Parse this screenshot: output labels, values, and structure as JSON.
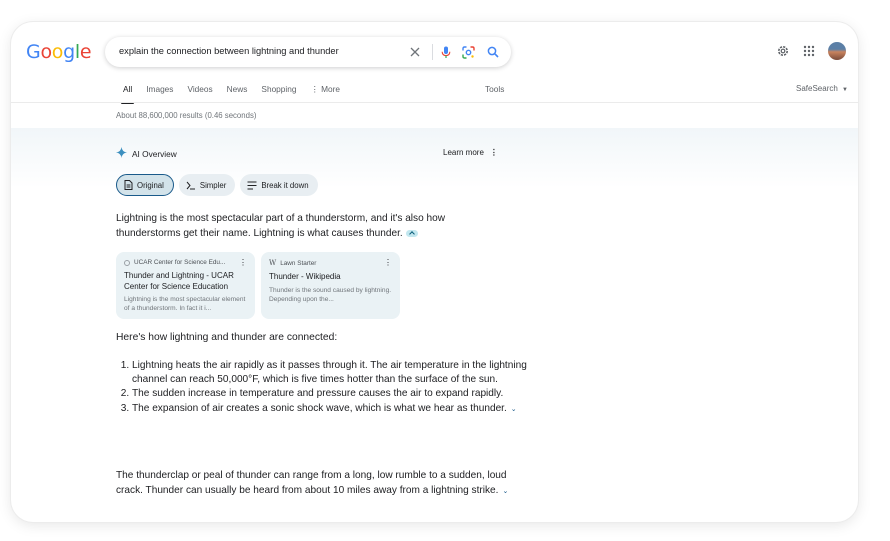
{
  "header": {
    "logo_letters": [
      "G",
      "o",
      "o",
      "g",
      "l",
      "e"
    ],
    "search_query": "explain the connection between lightning and thunder"
  },
  "tabs": [
    "All",
    "Images",
    "Videos",
    "News",
    "Shopping",
    "More"
  ],
  "tools_label": "Tools",
  "safesearch_label": "SafeSearch",
  "result_stats": "About 88,600,000 results (0.46 seconds)",
  "ai_overview": {
    "title": "AI Overview",
    "learn_more": "Learn more",
    "chips": [
      "Original",
      "Simpler",
      "Break it down"
    ],
    "intro": "Lightning is the most spectacular part of a thunderstorm, and it's also how thunderstorms get their name. Lightning is what causes thunder.",
    "sources": [
      {
        "site": "UCAR Center for Science Edu...",
        "title": "Thunder and Lightning - UCAR Center for Science Education",
        "snippet": "Lightning is the most spectacular element of a thunderstorm. In fact it i..."
      },
      {
        "site": "Lawn Starter",
        "title": "Thunder - Wikipedia",
        "snippet": "Thunder is the sound caused by lightning. Depending upon the..."
      }
    ],
    "subheading": "Here's how lightning and thunder are connected:",
    "steps": [
      "Lightning heats the air rapidly as it passes through it. The air temperature in the lightning channel can reach 50,000°F, which is five times hotter than the surface of the sun.",
      "The sudden increase in temperature and pressure causes the air to expand rapidly.",
      "The expansion of air creates a sonic shock wave, which is what we hear as thunder."
    ],
    "closing": "The thunderclap or peal of thunder can range from a long, low rumble to a sudden, loud crack. Thunder can usually be heard from about 10 miles away from a lightning strike."
  },
  "colors": {
    "accent": "#1a73e8",
    "ai_card_bg": "#eaf2f5",
    "chip_active_border": "#1a5a8a"
  }
}
